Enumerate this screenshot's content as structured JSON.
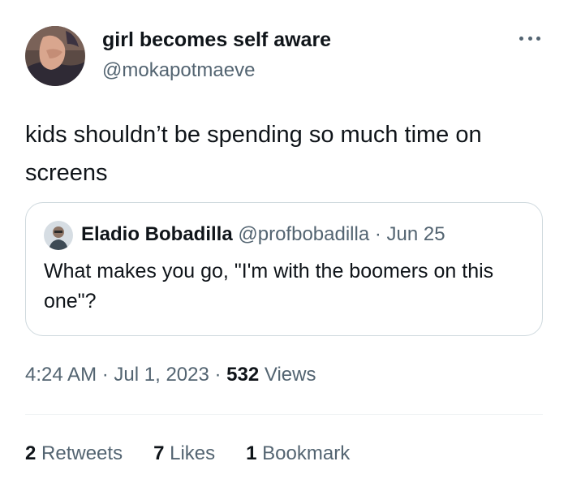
{
  "author": {
    "display_name": "girl becomes self aware",
    "handle": "@mokapotmaeve"
  },
  "tweet": {
    "text": "kids shouldn’t be spending so much time on screens"
  },
  "quoted_tweet": {
    "name": "Eladio Bobadilla",
    "handle": "@profbobadilla",
    "separator": "·",
    "date": "Jun 25",
    "text": "What makes you go, \"I'm with the boomers on this one\"?"
  },
  "meta": {
    "time": "4:24 AM",
    "sep1": "·",
    "date": "Jul 1, 2023",
    "sep2": "·",
    "views_count": "532",
    "views_label": "Views"
  },
  "stats": {
    "retweets_count": "2",
    "retweets_label": "Retweets",
    "likes_count": "7",
    "likes_label": "Likes",
    "bookmarks_count": "1",
    "bookmarks_label": "Bookmark"
  },
  "icons": {
    "more": "more-horizontal-icon"
  },
  "colors": {
    "primary_text": "#0f1419",
    "secondary_text": "#536471",
    "border": "#cfd9de",
    "divider": "#eff3f4"
  }
}
